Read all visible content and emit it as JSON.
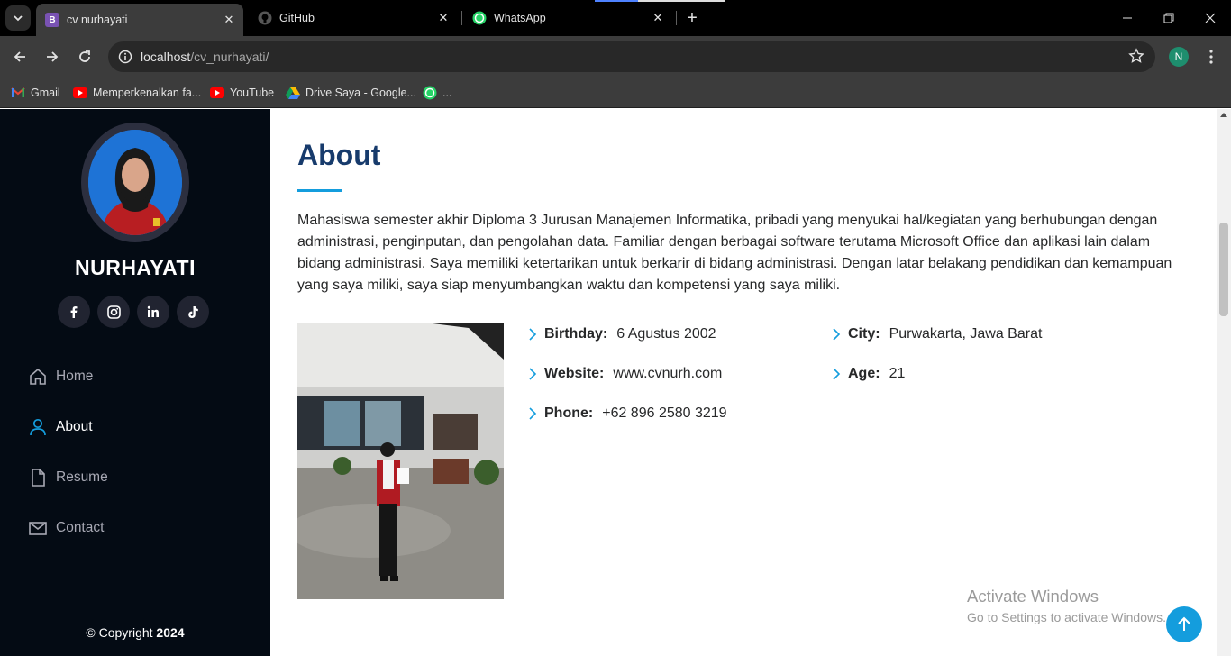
{
  "browser": {
    "tabs": [
      {
        "title": "cv nurhayati",
        "favicon": "bootstrap-icon",
        "active": true
      },
      {
        "title": "GitHub",
        "favicon": "github-icon",
        "active": false
      },
      {
        "title": "WhatsApp",
        "favicon": "whatsapp-icon",
        "active": false
      }
    ],
    "url_host": "localhost",
    "url_path": "/cv_nurhayati/",
    "profile_initial": "N",
    "bookmarks": [
      {
        "label": "Gmail",
        "icon": "gmail-icon"
      },
      {
        "label": "Memperkenalkan fa...",
        "icon": "youtube-icon"
      },
      {
        "label": "YouTube",
        "icon": "youtube-icon"
      },
      {
        "label": "Drive Saya - Google...",
        "icon": "drive-icon"
      },
      {
        "label": "...",
        "icon": "whatsapp-icon"
      }
    ]
  },
  "sidebar": {
    "name": "NURHAYATI",
    "social": [
      "facebook-icon",
      "instagram-icon",
      "linkedin-icon",
      "tiktok-icon"
    ],
    "nav": [
      {
        "label": "Home",
        "icon": "home-icon",
        "active": false
      },
      {
        "label": "About",
        "icon": "person-icon",
        "active": true
      },
      {
        "label": "Resume",
        "icon": "file-icon",
        "active": false
      },
      {
        "label": "Contact",
        "icon": "envelope-icon",
        "active": false
      }
    ],
    "copyright_prefix": "© Copyright",
    "copyright_year": "2024"
  },
  "about": {
    "heading": "About",
    "description": "Mahasiswa semester akhir Diploma 3 Jurusan Manajemen Informatika, pribadi yang menyukai hal/kegiatan yang berhubungan dengan administrasi, penginputan, dan pengolahan data. Familiar dengan berbagai software terutama Microsoft Office dan aplikasi lain dalam bidang administrasi. Saya memiliki ketertarikan untuk berkarir di bidang administrasi. Dengan latar belakang pendidikan dan kemampuan yang saya miliki, saya siap menyumbangkan waktu dan kompetensi yang saya miliki.",
    "facts": {
      "birthday_label": "Birthday:",
      "birthday": "6 Agustus 2002",
      "website_label": "Website:",
      "website": "www.cvnurh.com",
      "phone_label": "Phone:",
      "phone": "+62 896 2580 3219",
      "city_label": "City:",
      "city": "Purwakarta, Jawa Barat",
      "age_label": "Age:",
      "age": "21"
    }
  },
  "overlay": {
    "activate_title": "Activate Windows",
    "activate_sub": "Go to Settings to activate Windows."
  },
  "colors": {
    "accent": "#149ddd",
    "heading": "#173b6c",
    "sidebar_bg": "#040b14"
  }
}
